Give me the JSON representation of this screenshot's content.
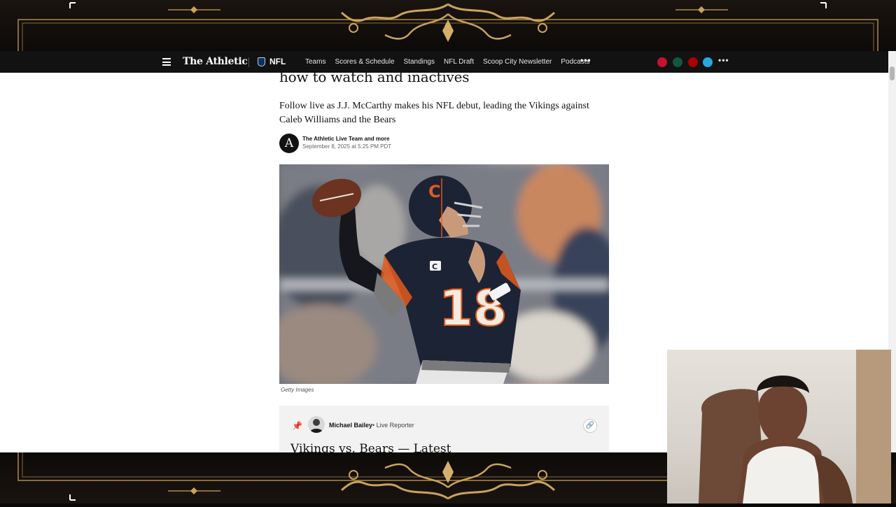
{
  "nav": {
    "brand": "The Athletic",
    "league": "NFL",
    "links": [
      "Teams",
      "Scores & Schedule",
      "Standings",
      "NFL Draft",
      "Scoop City Newsletter",
      "Podcasts"
    ],
    "more": "•••",
    "more_right": "•••",
    "team_colors": [
      "#c8102e",
      "#125740",
      "#aa0000",
      "#2aa7e0"
    ]
  },
  "article": {
    "headline_tail": "how to watch and inactives",
    "dek": "Follow live as J.J. McCarthy makes his NFL debut, leading the Vikings against Caleb Williams and the Bears",
    "avatar_letter": "A",
    "byline": "The Athletic Live Team and more",
    "dateline": "September 8, 2025 at 5:25 PM PDT",
    "hero": {
      "jersey_number": "18",
      "helmet_logo": "C",
      "captain_patch": "C"
    },
    "image_credit": "Getty Images"
  },
  "live_card": {
    "reporter_name": "Michael Bailey",
    "separator": "•",
    "reporter_role": "Live Reporter",
    "heading": "Vikings vs. Bears — Latest"
  },
  "colors": {
    "nav_bg": "#121212",
    "frame_gold": "#b08a4a",
    "bears_navy": "#1c2334",
    "bears_orange": "#e35b1e"
  }
}
